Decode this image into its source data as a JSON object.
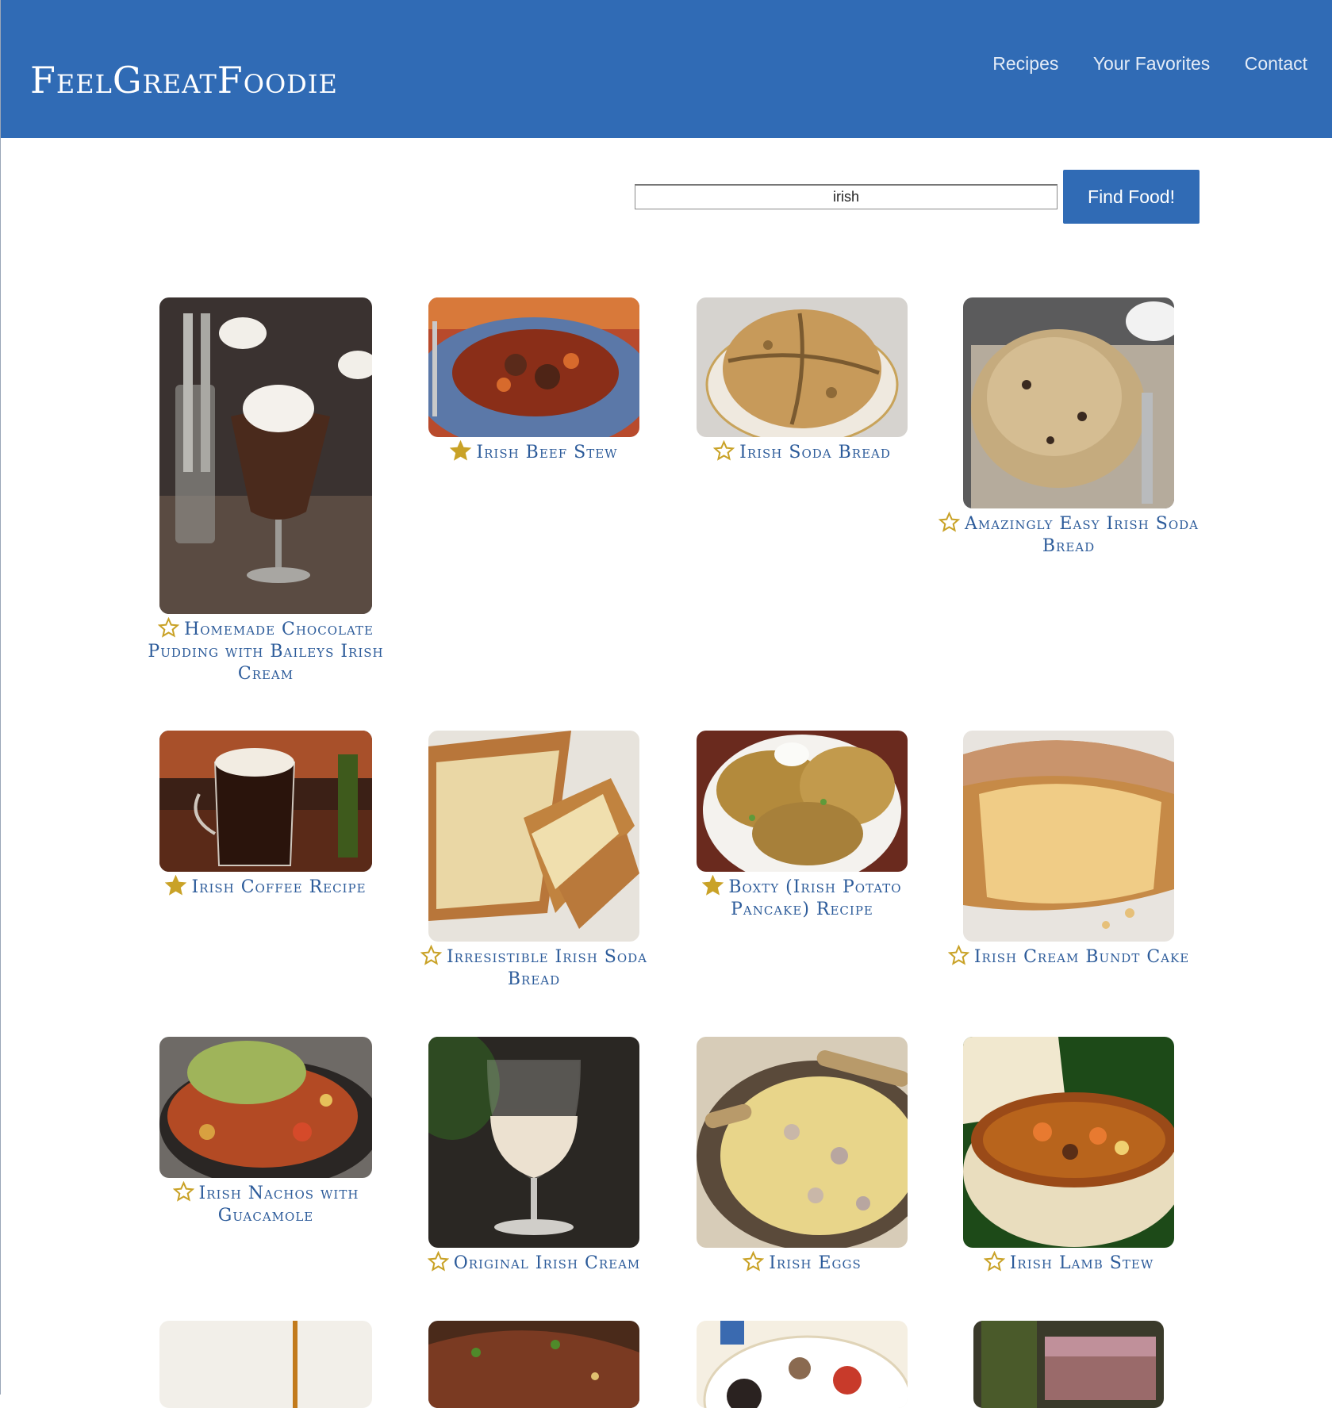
{
  "header": {
    "brand": "FeelGreatFoodie",
    "nav": [
      {
        "label": "Recipes"
      },
      {
        "label": "Your Favorites"
      },
      {
        "label": "Contact"
      }
    ]
  },
  "search": {
    "value": "irish",
    "button_label": "Find Food!"
  },
  "colors": {
    "header_bg": "#306bb5",
    "title_text": "#2c5b9a",
    "star_gold": "#c9a227"
  },
  "recipes": [
    {
      "title": "Homemade Chocolate Pudding with Baileys Irish Cream",
      "favorite": false,
      "image": "chocolate-pudding-photo"
    },
    {
      "title": "Irish Beef Stew",
      "favorite": true,
      "image": "beef-stew-photo"
    },
    {
      "title": "Irish Soda Bread",
      "favorite": false,
      "image": "soda-bread-photo"
    },
    {
      "title": "Amazingly Easy Irish Soda Bread",
      "favorite": false,
      "image": "easy-soda-bread-photo"
    },
    {
      "title": "Irish Coffee Recipe",
      "favorite": true,
      "image": "irish-coffee-photo"
    },
    {
      "title": "Irresistible Irish Soda Bread",
      "favorite": false,
      "image": "sliced-bread-photo"
    },
    {
      "title": "Boxty (Irish Potato Pancake) Recipe",
      "favorite": true,
      "image": "potato-pancake-photo"
    },
    {
      "title": "Irish Cream Bundt Cake",
      "favorite": false,
      "image": "bundt-cake-photo"
    },
    {
      "title": "Irish Nachos with Guacamole",
      "favorite": false,
      "image": "nachos-photo"
    },
    {
      "title": "Original Irish Cream",
      "favorite": false,
      "image": "irish-cream-glass-photo"
    },
    {
      "title": "Irish Eggs",
      "favorite": false,
      "image": "irish-eggs-photo"
    },
    {
      "title": "Irish Lamb Stew",
      "favorite": false,
      "image": "lamb-stew-photo"
    },
    {
      "title": "",
      "favorite": false,
      "image": "pouring-photo"
    },
    {
      "title": "",
      "favorite": false,
      "image": "steak-photo"
    },
    {
      "title": "",
      "favorite": false,
      "image": "breakfast-plate-photo"
    },
    {
      "title": "",
      "favorite": false,
      "image": "baileys-bars-photo"
    }
  ]
}
